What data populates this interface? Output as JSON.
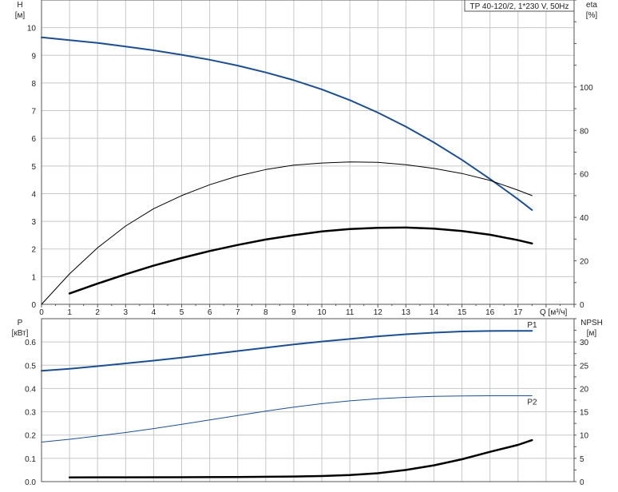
{
  "chart_data": [
    {
      "type": "line",
      "title": "TP 40-120/2, 1*230 V, 50Hz",
      "x_label": "Q [м³/ч]",
      "x_range": [
        0,
        19
      ],
      "x_ticks": [
        0,
        1,
        2,
        3,
        4,
        5,
        6,
        7,
        8,
        9,
        10,
        11,
        12,
        13,
        14,
        15,
        16,
        17
      ],
      "y_left_label": "H",
      "y_left_unit": "[м]",
      "y_left_range": [
        0,
        11
      ],
      "y_left_ticks": [
        0,
        1,
        2,
        3,
        4,
        5,
        6,
        7,
        8,
        9,
        10
      ],
      "y_right_label": "eta",
      "y_right_unit": "[%]",
      "y_right_range": [
        0,
        140
      ],
      "y_right_ticks": [
        0,
        20,
        40,
        60,
        80,
        100
      ],
      "grid": true,
      "series": [
        {
          "axis": "left",
          "color": "#1b4f8f",
          "width": 2,
          "x": [
            0,
            1,
            2,
            3,
            4,
            5,
            6,
            7,
            8,
            9,
            10,
            11,
            12,
            13,
            14,
            15,
            16,
            17,
            17.5
          ],
          "y": [
            9.65,
            9.55,
            9.45,
            9.32,
            9.18,
            9.02,
            8.84,
            8.63,
            8.38,
            8.1,
            7.77,
            7.38,
            6.93,
            6.42,
            5.85,
            5.22,
            4.53,
            3.8,
            3.41
          ]
        },
        {
          "axis": "right",
          "color": "#000000",
          "width": 1,
          "x": [
            0,
            1,
            2,
            3,
            4,
            5,
            6,
            7,
            8,
            9,
            10,
            11,
            12,
            13,
            14,
            15,
            16,
            17,
            17.5
          ],
          "y": [
            0,
            14,
            26,
            36,
            44,
            50,
            55,
            59,
            62,
            64,
            65,
            65.5,
            65.3,
            64.2,
            62.5,
            60.2,
            57,
            52.5,
            50
          ]
        },
        {
          "axis": "right",
          "color": "#000000",
          "width": 2.5,
          "x": [
            1,
            2,
            3,
            4,
            5,
            6,
            7,
            8,
            9,
            10,
            11,
            12,
            13,
            14,
            15,
            16,
            17,
            17.5
          ],
          "y": [
            5,
            9.5,
            13.8,
            17.8,
            21.3,
            24.5,
            27.3,
            29.8,
            31.8,
            33.5,
            34.6,
            35.2,
            35.3,
            34.8,
            33.7,
            32,
            29.5,
            28
          ]
        }
      ]
    },
    {
      "type": "line",
      "x_range": [
        0,
        19
      ],
      "y_left_label": "P",
      "y_left_unit": "[кВт]",
      "y_left_range": [
        0,
        0.7
      ],
      "y_left_ticks": [
        0.0,
        0.1,
        0.2,
        0.3,
        0.4,
        0.5,
        0.6
      ],
      "y_left_tick_labels": [
        "0.0",
        "0.1",
        "0.2",
        "0.3",
        "0.4",
        "0.5",
        "0.6"
      ],
      "y_right_label": "NPSH",
      "y_right_unit": "[м]",
      "y_right_range": [
        0,
        35
      ],
      "y_right_ticks": [
        0,
        5,
        10,
        15,
        20,
        25,
        30
      ],
      "grid": true,
      "series": [
        {
          "name": "P1",
          "axis": "left",
          "color": "#1b4f8f",
          "width": 2,
          "x": [
            0,
            1,
            2,
            3,
            4,
            5,
            6,
            7,
            8,
            9,
            10,
            11,
            12,
            13,
            14,
            15,
            16,
            17,
            17.5
          ],
          "y": [
            0.476,
            0.485,
            0.496,
            0.508,
            0.52,
            0.533,
            0.547,
            0.561,
            0.575,
            0.589,
            0.602,
            0.613,
            0.624,
            0.633,
            0.64,
            0.645,
            0.647,
            0.648,
            0.648
          ]
        },
        {
          "name": "P2",
          "axis": "left",
          "color": "#1b4f8f",
          "width": 1,
          "x": [
            0,
            1,
            2,
            3,
            4,
            5,
            6,
            7,
            8,
            9,
            10,
            11,
            12,
            13,
            14,
            15,
            16,
            17,
            17.5
          ],
          "y": [
            0.17,
            0.182,
            0.196,
            0.211,
            0.228,
            0.246,
            0.265,
            0.284,
            0.303,
            0.32,
            0.335,
            0.347,
            0.356,
            0.362,
            0.366,
            0.368,
            0.369,
            0.369,
            0.369
          ]
        },
        {
          "axis": "right",
          "color": "#000000",
          "width": 2.5,
          "x": [
            1,
            3,
            5,
            7,
            9,
            10,
            11,
            12,
            13,
            14,
            15,
            16,
            17,
            17.5
          ],
          "y": [
            0.9,
            0.92,
            0.95,
            1.0,
            1.1,
            1.2,
            1.4,
            1.8,
            2.5,
            3.5,
            4.8,
            6.4,
            7.9,
            8.9
          ]
        }
      ]
    }
  ]
}
